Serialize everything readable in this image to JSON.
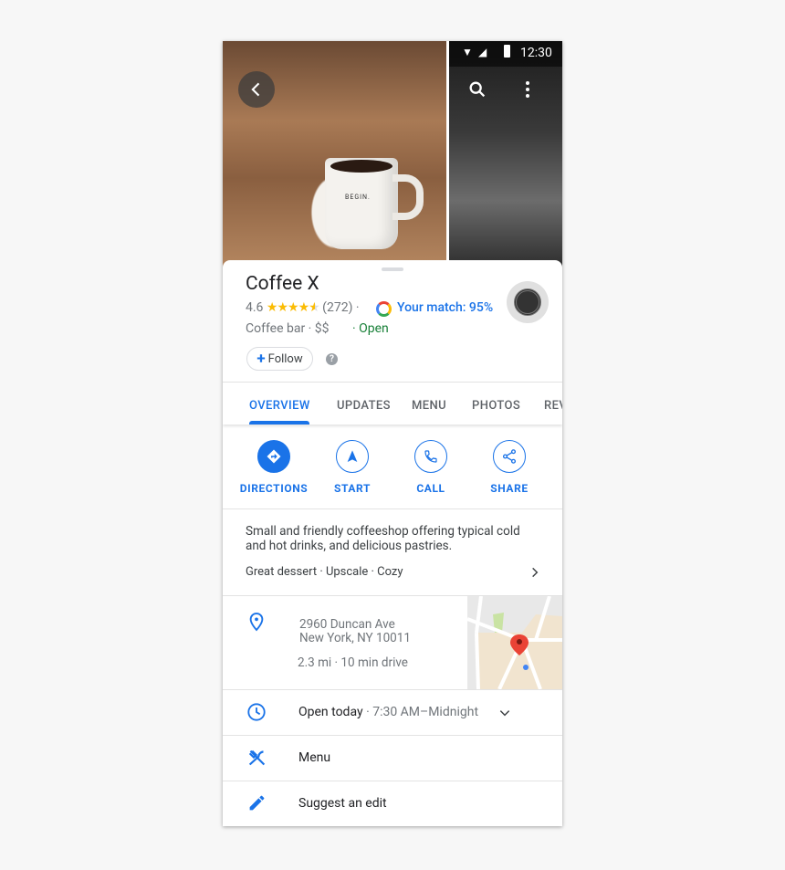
{
  "status_bar": {
    "time": "12:30"
  },
  "photo": {
    "mug_text": "BEGIN."
  },
  "place": {
    "name": "Coffee X",
    "rating": "4.6",
    "stars": 4.6,
    "review_count": "(272)",
    "match_label": "Your match: 95%",
    "category": "Coffee bar · $$",
    "open_status": "· Open",
    "follow_label": "Follow"
  },
  "tabs": [
    {
      "label": "OVERVIEW",
      "active": true
    },
    {
      "label": "UPDATES"
    },
    {
      "label": "MENU"
    },
    {
      "label": "PHOTOS"
    },
    {
      "label": "REVIEWS"
    }
  ],
  "actions": [
    {
      "label": "DIRECTIONS",
      "icon": "directions-icon"
    },
    {
      "label": "START",
      "icon": "navigation-icon"
    },
    {
      "label": "CALL",
      "icon": "phone-icon"
    },
    {
      "label": "SHARE",
      "icon": "share-icon"
    }
  ],
  "description": {
    "line1": "Small and friendly coffeeshop offering typical cold",
    "line2": "and hot drinks, and delicious pastries.",
    "tags": "Great dessert · Upscale · Cozy"
  },
  "address": {
    "line1": "2960 Duncan Ave",
    "line2": "New York, NY 10011",
    "distance": "2.3 mi · 10 min drive"
  },
  "hours": {
    "label": "Open today",
    "value": " · 7:30 AM–Midnight"
  },
  "menu_label": "Menu",
  "suggest_label": "Suggest an edit",
  "colors": {
    "accent": "#1a73e8",
    "open": "#188038",
    "star": "#fbbc04",
    "pin": "#ea4335"
  }
}
